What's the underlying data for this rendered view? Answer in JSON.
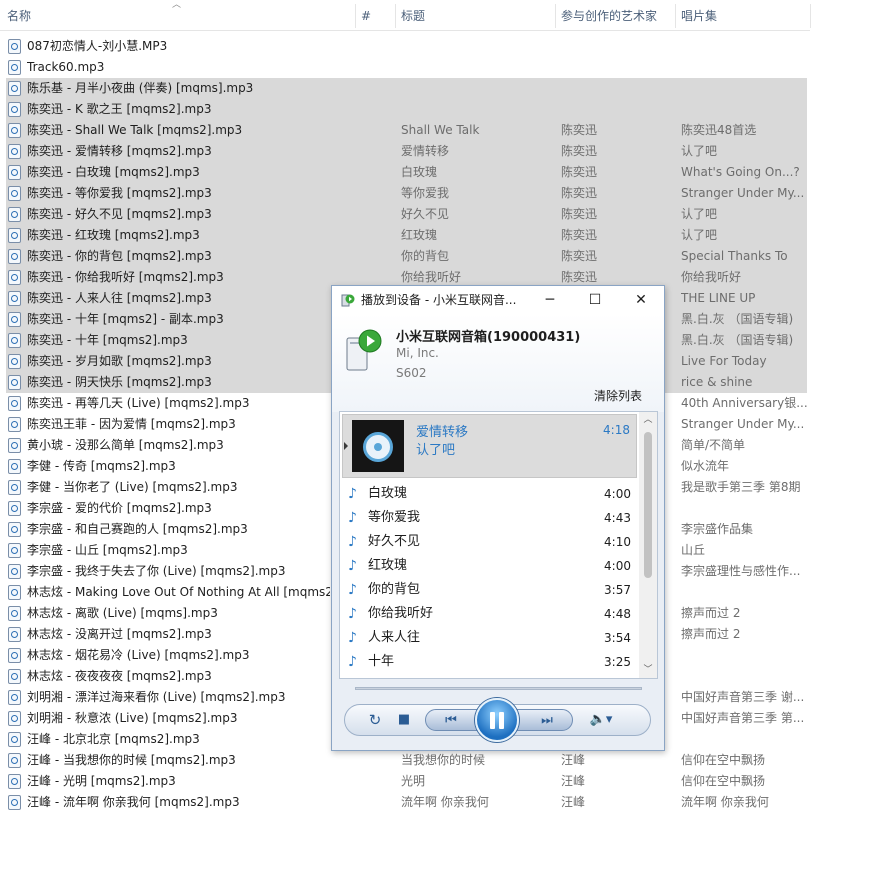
{
  "columns": {
    "name": "名称",
    "track_no": "#",
    "title": "标题",
    "artists": "参与创作的艺术家",
    "album": "唱片集"
  },
  "files": [
    {
      "name": "087初恋情人-刘小慧.MP3",
      "title": "",
      "artist": "",
      "album": "",
      "selected": false
    },
    {
      "name": "Track60.mp3",
      "title": "",
      "artist": "",
      "album": "",
      "selected": false
    },
    {
      "name": "陈乐基 - 月半小夜曲 (伴奏) [mqms].mp3",
      "title": "",
      "artist": "",
      "album": "",
      "selected": true
    },
    {
      "name": "陈奕迅 - K 歌之王 [mqms2].mp3",
      "title": "",
      "artist": "",
      "album": "",
      "selected": true
    },
    {
      "name": "陈奕迅 - Shall  We  Talk [mqms2].mp3",
      "title": "Shall  We  Talk",
      "artist": "陈奕迅",
      "album": "陈奕迅48首选",
      "selected": true
    },
    {
      "name": "陈奕迅 - 爱情转移 [mqms2].mp3",
      "title": "爱情转移",
      "artist": "陈奕迅",
      "album": "认了吧",
      "selected": true
    },
    {
      "name": "陈奕迅 - 白玫瑰 [mqms2].mp3",
      "title": "白玫瑰",
      "artist": "陈奕迅",
      "album": "What's Going On...?",
      "selected": true
    },
    {
      "name": "陈奕迅 - 等你爱我 [mqms2].mp3",
      "title": "等你爱我",
      "artist": "陈奕迅",
      "album": "Stranger Under My...",
      "selected": true
    },
    {
      "name": "陈奕迅 - 好久不见 [mqms2].mp3",
      "title": "好久不见",
      "artist": "陈奕迅",
      "album": "认了吧",
      "selected": true
    },
    {
      "name": "陈奕迅 - 红玫瑰 [mqms2].mp3",
      "title": "红玫瑰",
      "artist": "陈奕迅",
      "album": "认了吧",
      "selected": true
    },
    {
      "name": "陈奕迅 - 你的背包 [mqms2].mp3",
      "title": "你的背包",
      "artist": "陈奕迅",
      "album": "Special Thanks To",
      "selected": true
    },
    {
      "name": "陈奕迅 - 你给我听好 [mqms2].mp3",
      "title": "你给我听好",
      "artist": "陈奕迅",
      "album": "你给我听好",
      "selected": true
    },
    {
      "name": "陈奕迅 - 人来人往 [mqms2].mp3",
      "title": "",
      "artist": "",
      "album": "THE LINE UP",
      "selected": true
    },
    {
      "name": "陈奕迅 - 十年 [mqms2] - 副本.mp3",
      "title": "",
      "artist": "",
      "album": "黑.白.灰 （国语专辑)",
      "selected": true
    },
    {
      "name": "陈奕迅 - 十年 [mqms2].mp3",
      "title": "",
      "artist": "",
      "album": "黑.白.灰 （国语专辑)",
      "selected": true
    },
    {
      "name": "陈奕迅 - 岁月如歌 [mqms2].mp3",
      "title": "",
      "artist": "",
      "album": "Live For Today",
      "selected": true
    },
    {
      "name": "陈奕迅 - 阴天快乐 [mqms2].mp3",
      "title": "",
      "artist": "",
      "album": "rice & shine",
      "selected": true
    },
    {
      "name": "陈奕迅 - 再等几天 (Live) [mqms2].mp3",
      "title": "",
      "artist": "",
      "album": "40th Anniversary银...",
      "selected": false
    },
    {
      "name": "陈奕迅王菲 - 因为爱情 [mqms2].mp3",
      "title": "",
      "artist": "",
      "album": "Stranger Under My...",
      "selected": false
    },
    {
      "name": "黄小琥 - 没那么简单 [mqms2].mp3",
      "title": "",
      "artist": "",
      "album": "简单/不简单",
      "selected": false
    },
    {
      "name": "李健 - 传奇 [mqms2].mp3",
      "title": "",
      "artist": "",
      "album": "似水流年",
      "selected": false
    },
    {
      "name": "李健 - 当你老了 (Live) [mqms2].mp3",
      "title": "",
      "artist": "",
      "album": "我是歌手第三季 第8期",
      "selected": false
    },
    {
      "name": "李宗盛 - 爱的代价 [mqms2].mp3",
      "title": "",
      "artist": "",
      "album": "",
      "selected": false
    },
    {
      "name": "李宗盛 - 和自己赛跑的人 [mqms2].mp3",
      "title": "",
      "artist": "",
      "album": "李宗盛作品集",
      "selected": false
    },
    {
      "name": "李宗盛 - 山丘 [mqms2].mp3",
      "title": "",
      "artist": "",
      "album": "山丘",
      "selected": false
    },
    {
      "name": "李宗盛 - 我终于失去了你 (Live) [mqms2].mp3",
      "title": "",
      "artist": "",
      "album": "李宗盛理性与感性作...",
      "selected": false
    },
    {
      "name": "林志炫 - Making Love Out Of Nothing At All [mqms2",
      "title": "",
      "artist": "",
      "album": "",
      "selected": false
    },
    {
      "name": "林志炫 - 离歌 (Live) [mqms].mp3",
      "title": "",
      "artist": "",
      "album": "擦声而过 2",
      "selected": false
    },
    {
      "name": "林志炫 - 没离开过 [mqms2].mp3",
      "title": "",
      "artist": "",
      "album": "擦声而过 2",
      "selected": false
    },
    {
      "name": "林志炫 - 烟花易冷 (Live) [mqms2].mp3",
      "title": "",
      "artist": "",
      "album": "",
      "selected": false
    },
    {
      "name": "林志炫 - 夜夜夜夜 [mqms2].mp3",
      "title": "",
      "artist": "",
      "album": "",
      "selected": false
    },
    {
      "name": "刘明湘 - 漂洋过海来看你 (Live) [mqms2].mp3",
      "title": "",
      "artist": "",
      "album": "中国好声音第三季 谢...",
      "selected": false
    },
    {
      "name": "刘明湘 - 秋意浓 (Live) [mqms2].mp3",
      "title": "",
      "artist": "",
      "album": "中国好声音第三季 第...",
      "selected": false
    },
    {
      "name": "汪峰 - 北京北京 [mqms2].mp3",
      "title": "",
      "artist": "",
      "album": "",
      "selected": false
    },
    {
      "name": "汪峰 - 当我想你的时候 [mqms2].mp3",
      "title": "当我想你的时候",
      "artist": "汪峰",
      "album": "信仰在空中飘扬",
      "selected": false
    },
    {
      "name": "汪峰 - 光明 [mqms2].mp3",
      "title": "光明",
      "artist": "汪峰",
      "album": "信仰在空中飘扬",
      "selected": false
    },
    {
      "name": "汪峰 - 流年啊 你亲我何 [mqms2].mp3",
      "title": "流年啊 你亲我何",
      "artist": "汪峰",
      "album": "流年啊 你亲我何",
      "selected": false
    }
  ],
  "dialog": {
    "title": "播放到设备 - 小米互联网音...",
    "device_name": "小米互联网音箱(190000431)",
    "manufacturer": "Mi, Inc.",
    "model": "S602",
    "clear_list": "清除列表",
    "now_playing": {
      "title": "爱情转移",
      "album": "认了吧",
      "duration": "4:18"
    },
    "tracks": [
      {
        "name": "白玫瑰",
        "duration": "4:00"
      },
      {
        "name": "等你爱我",
        "duration": "4:43"
      },
      {
        "name": "好久不见",
        "duration": "4:10"
      },
      {
        "name": "红玫瑰",
        "duration": "4:00"
      },
      {
        "name": "你的背包",
        "duration": "3:57"
      },
      {
        "name": "你给我听好",
        "duration": "4:48"
      },
      {
        "name": "人来人往",
        "duration": "3:54"
      },
      {
        "name": "十年",
        "duration": "3:25"
      }
    ],
    "icons": {
      "minimize": "minimize-icon",
      "maximize": "maximize-icon",
      "close": "close-icon",
      "repeat": "repeat-icon",
      "stop": "stop-icon",
      "previous": "previous-icon",
      "pause": "pause-icon",
      "next": "next-icon",
      "volume": "volume-icon"
    },
    "accent_color": "#2b79c4"
  }
}
